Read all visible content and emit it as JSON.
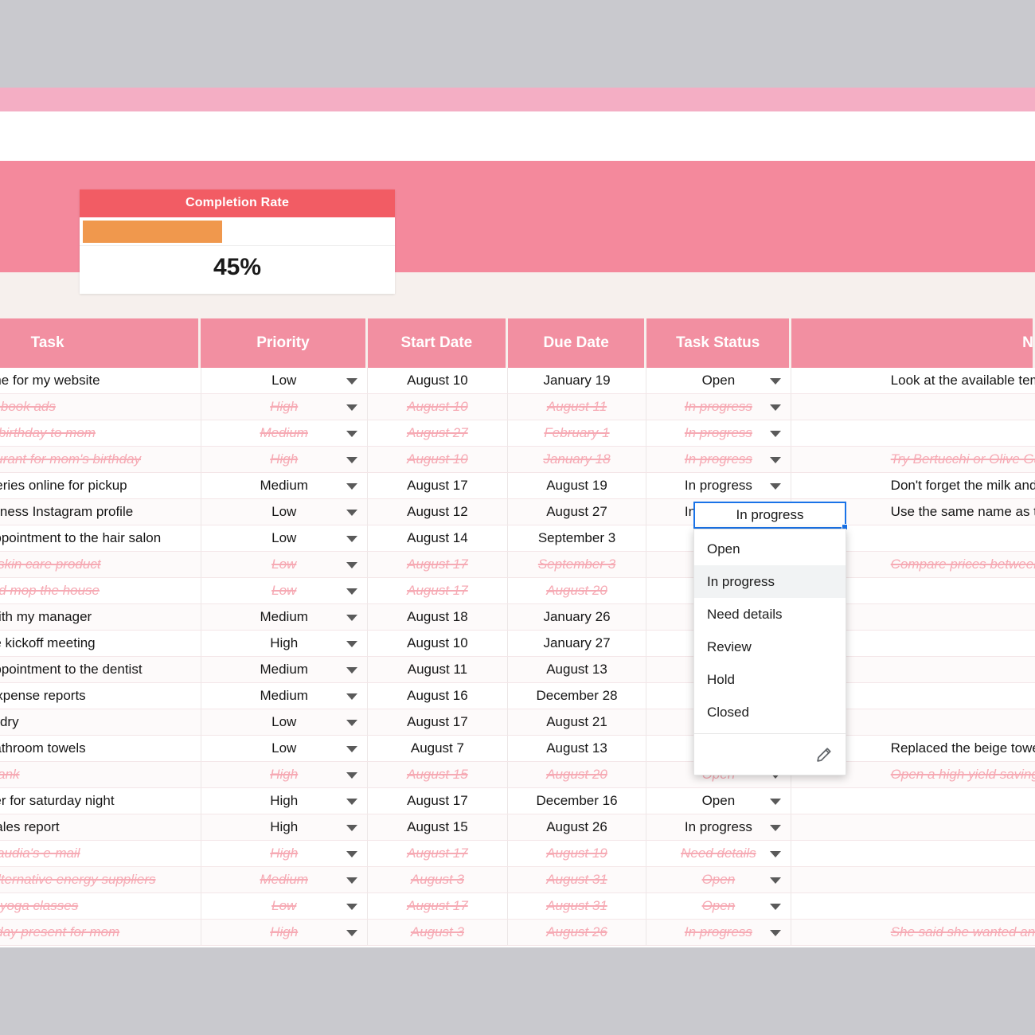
{
  "widget": {
    "title": "Completion Rate",
    "value_label": "45%",
    "progress_percent": 45,
    "header_color": "#f25c64",
    "bar_color": "#f0984d"
  },
  "table": {
    "header_color": "#f28fa1",
    "columns": [
      "Task",
      "Priority",
      "Start Date",
      "Due Date",
      "Task Status",
      "Notes"
    ],
    "rows": [
      {
        "task": "Pick a theme for my website",
        "priority": "Low",
        "start": "August 10",
        "due": "January 19",
        "status": "Open",
        "notes": "Look at the available templates",
        "done": false
      },
      {
        "task": "Create facebook ads",
        "priority": "High",
        "start": "August 10",
        "due": "August 11",
        "status": "In progress",
        "notes": "",
        "done": true
      },
      {
        "task": "Say happy birthday to mom",
        "priority": "Medium",
        "start": "August 27",
        "due": "February 1",
        "status": "In progress",
        "notes": "",
        "done": true
      },
      {
        "task": "Book restaurant for mom's birthday",
        "priority": "High",
        "start": "August 10",
        "due": "January 18",
        "status": "In progress",
        "notes": "Try Bertucchi or Olive Garden",
        "done": true
      },
      {
        "task": "Order groceries online for pickup",
        "priority": "Medium",
        "start": "August 17",
        "due": "August 19",
        "status": "In progress",
        "notes": "Don't forget the milk and eggs",
        "done": false
      },
      {
        "task": "Create business Instagram profile",
        "priority": "Low",
        "start": "August 12",
        "due": "August 27",
        "status": "In progress",
        "notes": "Use the same name as the website",
        "done": false
      },
      {
        "task": "Make an appointment to the hair salon",
        "priority": "Low",
        "start": "August 14",
        "due": "September 3",
        "status": "",
        "notes": "",
        "done": false
      },
      {
        "task": "Buy a new skin care product",
        "priority": "Low",
        "start": "August 17",
        "due": "September 3",
        "status": "",
        "notes": "Compare prices between drugstores",
        "done": true
      },
      {
        "task": "Vacuum and mop the house",
        "priority": "Low",
        "start": "August 17",
        "due": "August 20",
        "status": "",
        "notes": "",
        "done": true
      },
      {
        "task": "Catch up with my manager",
        "priority": "Medium",
        "start": "August 18",
        "due": "January 26",
        "status": "",
        "notes": "",
        "done": false
      },
      {
        "task": "Prepare the kickoff meeting",
        "priority": "High",
        "start": "August 10",
        "due": "January 27",
        "status": "",
        "notes": "",
        "done": false
      },
      {
        "task": "Make an appointment to the dentist",
        "priority": "Medium",
        "start": "August 11",
        "due": "August 13",
        "status": "",
        "notes": "",
        "done": false
      },
      {
        "task": "Send the expense reports",
        "priority": "Medium",
        "start": "August 16",
        "due": "December 28",
        "status": "",
        "notes": "",
        "done": false
      },
      {
        "task": "Do the laundry",
        "priority": "Low",
        "start": "August 17",
        "due": "August 21",
        "status": "",
        "notes": "",
        "done": false
      },
      {
        "task": "Buy new bathroom towels",
        "priority": "Low",
        "start": "August 7",
        "due": "August 13",
        "status": "",
        "notes": "Replaced the beige towels",
        "done": false
      },
      {
        "task": "Go to the bank",
        "priority": "High",
        "start": "August 15",
        "due": "August 20",
        "status": "Open",
        "notes": "Open a high yield savings account",
        "done": true
      },
      {
        "task": "Book a sitter for saturday night",
        "priority": "High",
        "start": "August 17",
        "due": "December 16",
        "status": "Open",
        "notes": "",
        "done": false
      },
      {
        "task": "Send the sales report",
        "priority": "High",
        "start": "August 15",
        "due": "August 26",
        "status": "In progress",
        "notes": "",
        "done": false
      },
      {
        "task": "Reply to Claudia's e-mail",
        "priority": "High",
        "start": "August 17",
        "due": "August 19",
        "status": "Need details",
        "notes": "",
        "done": true
      },
      {
        "task": "Compare alternative energy suppliers",
        "priority": "Medium",
        "start": "August 3",
        "due": "August 31",
        "status": "Open",
        "notes": "",
        "done": true
      },
      {
        "task": "Sign up for yoga classes",
        "priority": "Low",
        "start": "August 17",
        "due": "August 31",
        "status": "Open",
        "notes": "",
        "done": true
      },
      {
        "task": "Buy a birthday present for mom",
        "priority": "High",
        "start": "August 3",
        "due": "August 26",
        "status": "In progress",
        "notes": "She said she wanted an apron",
        "done": true
      }
    ]
  },
  "selected_cell": {
    "value": "In progress",
    "border_color": "#1a73e8"
  },
  "dropdown": {
    "options": [
      "Open",
      "In progress",
      "Need details",
      "Review",
      "Hold",
      "Closed"
    ],
    "active_option": "In progress",
    "edit_icon": "pencil-icon"
  }
}
